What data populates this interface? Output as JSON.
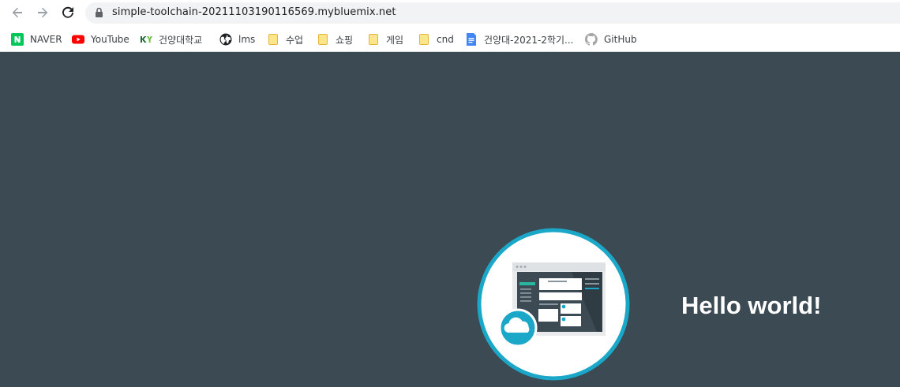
{
  "browser": {
    "url": "simple-toolchain-20211103190116569.mybluemix.net"
  },
  "bookmarks": [
    {
      "label": "NAVER",
      "icon": "naver-icon"
    },
    {
      "label": "YouTube",
      "icon": "youtube-icon"
    },
    {
      "label": "건양대학교",
      "icon": "konyang-icon"
    },
    {
      "label": "lms",
      "icon": "globe-icon"
    },
    {
      "label": "수업",
      "icon": "folder-icon"
    },
    {
      "label": "쇼핑",
      "icon": "folder-icon"
    },
    {
      "label": "게임",
      "icon": "folder-icon"
    },
    {
      "label": "cnd",
      "icon": "folder-icon"
    },
    {
      "label": "건양대-2021-2학기...",
      "icon": "google-docs-icon"
    },
    {
      "label": "GitHub",
      "icon": "github-icon"
    }
  ],
  "content": {
    "heading": "Hello world!"
  },
  "colors": {
    "background": "#3b4a53",
    "ring": "#1aa7c8",
    "heading": "#ffffff"
  }
}
